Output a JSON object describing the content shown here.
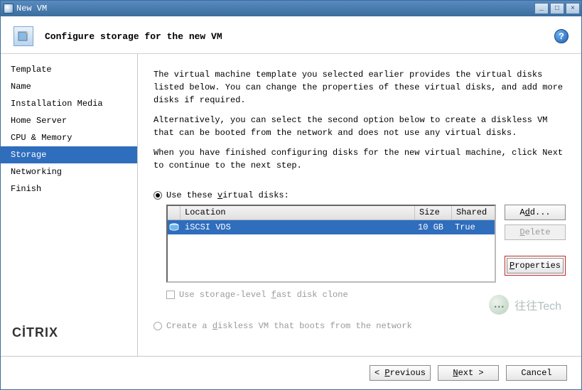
{
  "window": {
    "title": "New VM",
    "minimize": "_",
    "maximize": "□",
    "close": "×"
  },
  "header": {
    "title": "Configure storage for the new VM",
    "help_glyph": "?"
  },
  "sidebar": {
    "items": [
      {
        "label": "Template"
      },
      {
        "label": "Name"
      },
      {
        "label": "Installation Media"
      },
      {
        "label": "Home Server"
      },
      {
        "label": "CPU & Memory"
      },
      {
        "label": "Storage",
        "selected": true
      },
      {
        "label": "Networking"
      },
      {
        "label": "Finish"
      }
    ],
    "brand": "CİTRIX"
  },
  "intro": {
    "p1": "The virtual machine template you selected earlier provides the virtual disks listed below. You can change the properties of these virtual disks, and add more disks if required.",
    "p2": "Alternatively, you can select the second option below to create a diskless VM that can be booted from the network and does not use any virtual disks.",
    "p3": "When you have finished configuring disks for the new virtual machine, click Next to continue to the next step."
  },
  "options": {
    "use_disks_prefix": "Use these ",
    "use_disks_key": "v",
    "use_disks_suffix": "irtual disks:",
    "diskless_prefix": "Create a ",
    "diskless_key": "d",
    "diskless_suffix": "iskless VM that boots from the network"
  },
  "grid": {
    "headers": {
      "location": "Location",
      "size": "Size",
      "shared": "Shared"
    },
    "row": {
      "location": "iSCSI VDS",
      "size": "10 GB",
      "shared": "True"
    }
  },
  "buttons": {
    "add_pre": "A",
    "add_key": "d",
    "add_post": "d...",
    "delete_pre": "",
    "delete_key": "D",
    "delete_post": "elete",
    "props_pre": "",
    "props_key": "P",
    "props_post": "roperties"
  },
  "fastclone": {
    "pre": "Use storage-level ",
    "key": "f",
    "post": "ast disk clone"
  },
  "footer": {
    "prev_pre": "< ",
    "prev_key": "P",
    "prev_post": "revious",
    "next_key": "N",
    "next_post": "ext >",
    "cancel": "Cancel"
  },
  "watermark": {
    "glyph": "…",
    "text": "往往Tech"
  }
}
